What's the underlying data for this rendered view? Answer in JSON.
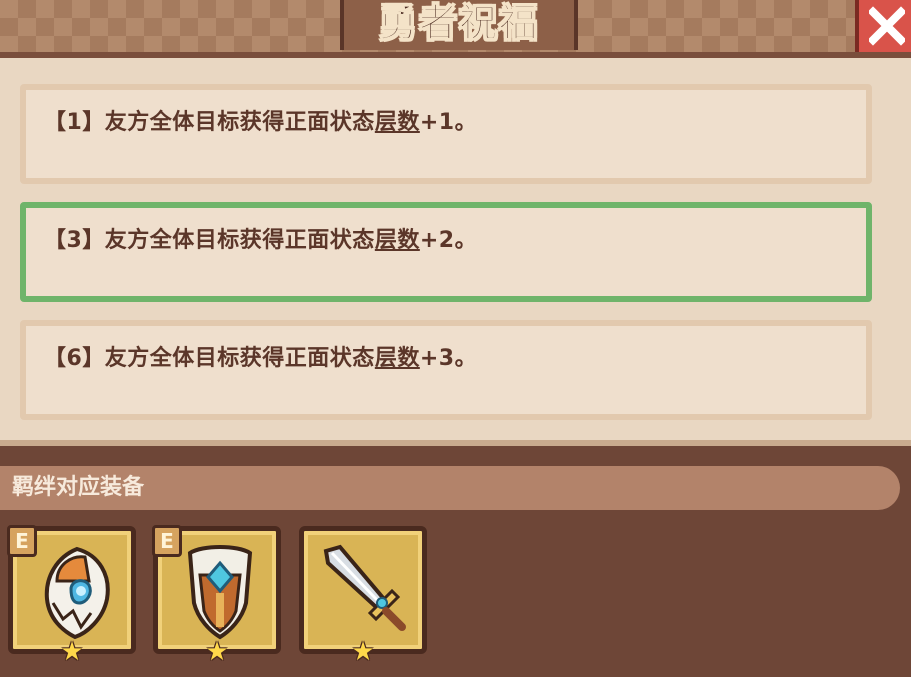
{
  "title": "勇者祝福",
  "effects": [
    {
      "prefix": "【1】友方全体目标获得正面状态",
      "keyword": "层数",
      "suffix": "+1。",
      "selected": false
    },
    {
      "prefix": "【3】友方全体目标获得正面状态",
      "keyword": "层数",
      "suffix": "+2。",
      "selected": true
    },
    {
      "prefix": "【6】友方全体目标获得正面状态",
      "keyword": "层数",
      "suffix": "+3。",
      "selected": false
    }
  ],
  "section_label": "羁绊对应装备",
  "equipment": [
    {
      "icon": "wing-shield-icon",
      "badge": "E",
      "stars": "★"
    },
    {
      "icon": "gem-shield-icon",
      "badge": "E",
      "stars": "★"
    },
    {
      "icon": "sword-icon",
      "badge": "",
      "stars": "★"
    }
  ],
  "colors": {
    "background": "#6e4637",
    "panel": "#e9d7c2",
    "selected_border": "#6fb46a",
    "close_button": "#d9534a"
  }
}
